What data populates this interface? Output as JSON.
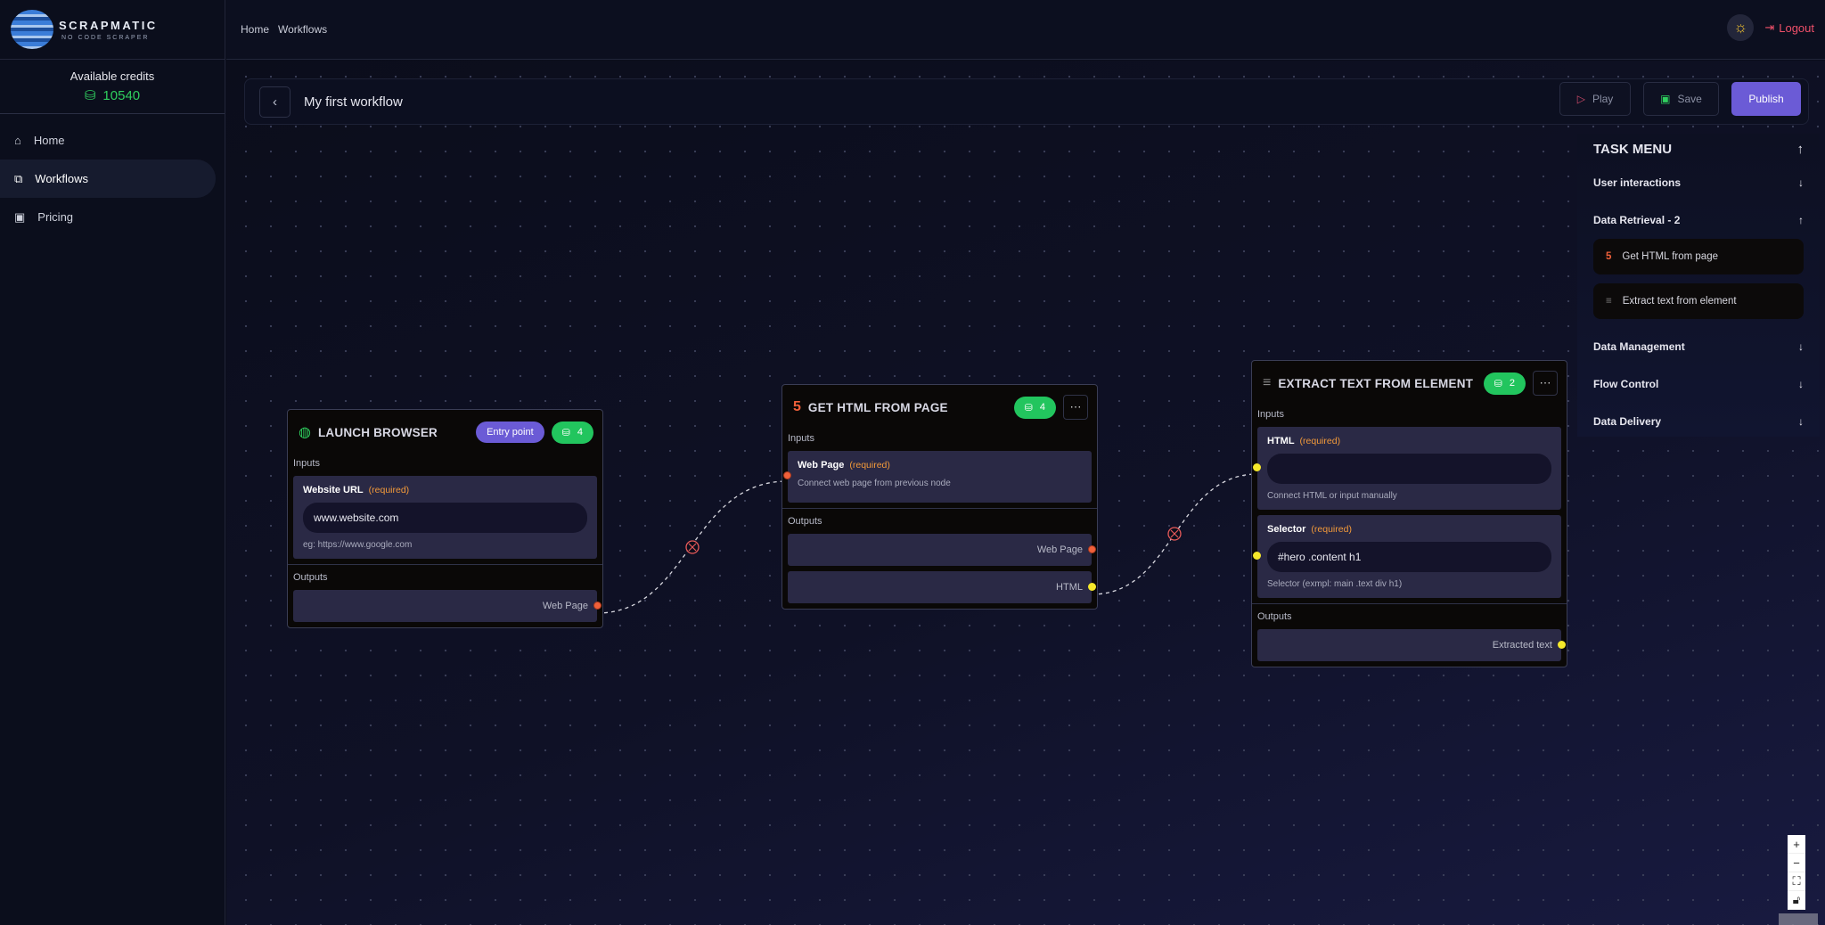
{
  "brand": {
    "name": "SCRAPMATIC",
    "tagline": "NO CODE SCRAPER"
  },
  "credits": {
    "label": "Available credits",
    "value": "10540"
  },
  "sidebar": {
    "items": [
      {
        "label": "Home",
        "icon": "home-icon"
      },
      {
        "label": "Workflows",
        "icon": "workflow-icon",
        "active": true
      },
      {
        "label": "Pricing",
        "icon": "banknote-icon"
      }
    ]
  },
  "breadcrumb": [
    "Home",
    "Workflows"
  ],
  "topbar": {
    "logout": "Logout",
    "theme_icon": "sun-icon"
  },
  "workflow": {
    "title": "My first workflow",
    "play": "Play",
    "save": "Save",
    "publish": "Publish"
  },
  "task_menu": {
    "title": "TASK MENU",
    "sections": [
      {
        "label": "User interactions",
        "expanded": false
      },
      {
        "label": "Data Retrieval - 2",
        "expanded": true,
        "items": [
          "Get HTML from page",
          "Extract text from element"
        ]
      },
      {
        "label": "Data Management",
        "expanded": false
      },
      {
        "label": "Flow Control",
        "expanded": false
      },
      {
        "label": "Data Delivery",
        "expanded": false
      }
    ]
  },
  "nodes": {
    "launch": {
      "title": "LAUNCH BROWSER",
      "entry": "Entry point",
      "cost": "4",
      "inputs_label": "Inputs",
      "outputs_label": "Outputs",
      "field": {
        "label": "Website URL",
        "required": "(required)",
        "value": "www.website.com",
        "hint": "eg: https://www.google.com"
      },
      "output": "Web Page"
    },
    "gethtml": {
      "title": "GET HTML FROM PAGE",
      "cost": "4",
      "inputs_label": "Inputs",
      "outputs_label": "Outputs",
      "field": {
        "label": "Web Page",
        "required": "(required)",
        "hint": "Connect web page from previous node"
      },
      "outputs": [
        "Web Page",
        "HTML"
      ]
    },
    "extract": {
      "title": "EXTRACT TEXT FROM ELEMENT",
      "cost": "2",
      "inputs_label": "Inputs",
      "outputs_label": "Outputs",
      "fields": [
        {
          "label": "HTML",
          "required": "(required)",
          "value": "",
          "hint": "Connect HTML or input manually"
        },
        {
          "label": "Selector",
          "required": "(required)",
          "value": "#hero .content h1",
          "hint": "Selector (exmpl: main .text div h1)"
        }
      ],
      "output": "Extracted text"
    }
  },
  "colors": {
    "accent": "#6b5bd6",
    "credit": "#22c55e",
    "required": "#f39a3a",
    "webpage_handle": "#f0603a",
    "html_handle": "#f5e82a",
    "logout": "#f0506a"
  }
}
